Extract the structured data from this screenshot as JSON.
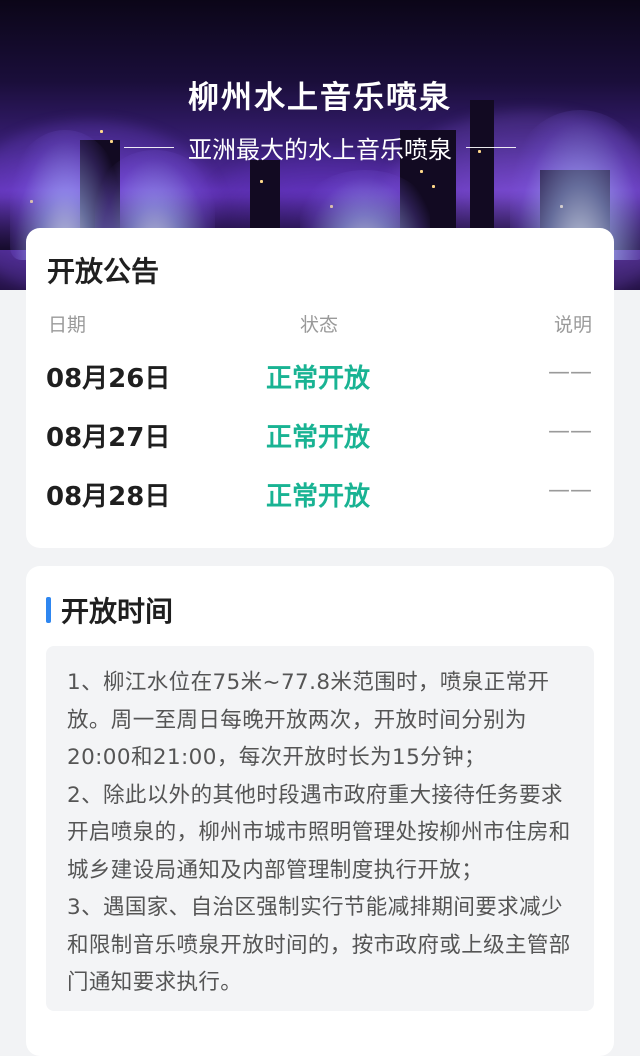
{
  "hero": {
    "title": "柳州水上音乐喷泉",
    "subtitle": "亚洲最大的水上音乐喷泉"
  },
  "notice": {
    "title": "开放公告",
    "headers": {
      "date": "日期",
      "status": "状态",
      "note": "说明"
    },
    "rows": [
      {
        "date": "08月26日",
        "status": "正常开放",
        "note": "——"
      },
      {
        "date": "08月27日",
        "status": "正常开放",
        "note": "——"
      },
      {
        "date": "08月28日",
        "status": "正常开放",
        "note": "——"
      }
    ]
  },
  "hours": {
    "title": "开放时间",
    "paragraphs": [
      "1、柳江水位在75米~77.8米范围时，喷泉正常开放。周一至周日每晚开放两次，开放时间分别为20:00和21:00，每次开放时长为15分钟；",
      "2、除此以外的其他时段遇市政府重大接待任务要求开启喷泉的，柳州市城市照明管理处按柳州市住房和城乡建设局通知及内部管理制度执行开放；",
      "3、遇国家、自治区强制实行节能减排期间要求减少和限制音乐喷泉开放时间的，按市政府或上级主管部门通知要求执行。"
    ]
  },
  "colors": {
    "status_green": "#19b393",
    "accent_blue": "#2e86f0"
  }
}
